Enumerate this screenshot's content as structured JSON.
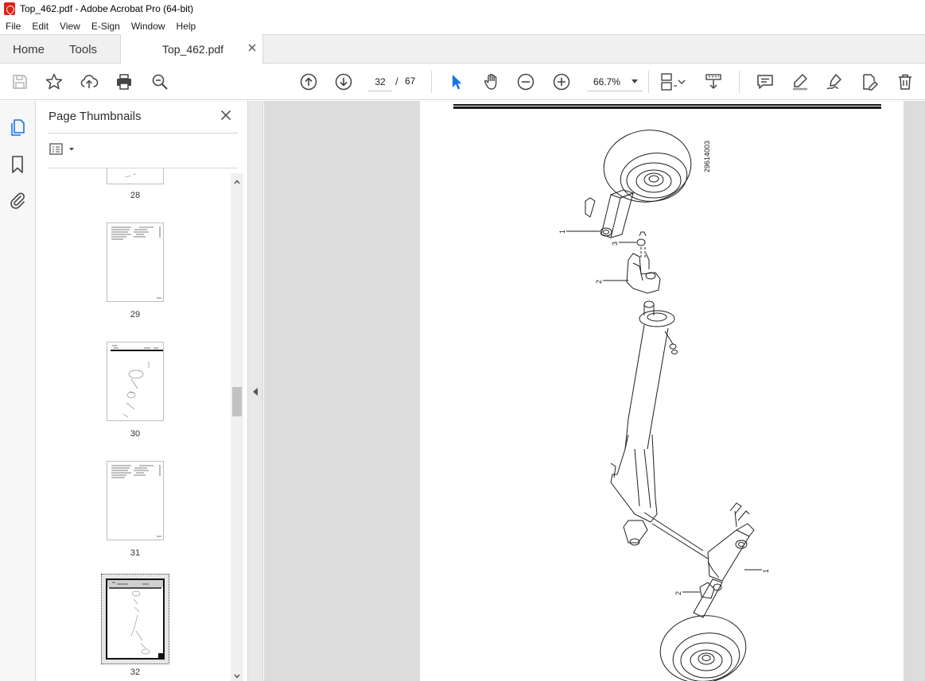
{
  "window": {
    "title": "Top_462.pdf - Adobe Acrobat Pro (64-bit)"
  },
  "menu": [
    "File",
    "Edit",
    "View",
    "E-Sign",
    "Window",
    "Help"
  ],
  "tabs": {
    "home": "Home",
    "tools": "Tools",
    "document": "Top_462.pdf"
  },
  "toolbar": {
    "current_page": "32",
    "separator": "/",
    "total_pages": "67",
    "zoom": "66.7%"
  },
  "thumbnails_panel": {
    "title": "Page Thumbnails",
    "pages": [
      "28",
      "29",
      "30",
      "31",
      "32"
    ],
    "selected_page": "32"
  },
  "document_page": {
    "figure_id": "29614003",
    "callouts": [
      "1",
      "3",
      "2",
      "1",
      "2"
    ]
  },
  "colors": {
    "accent": "#1473e6",
    "acrobat_red": "#e22017",
    "workspace": "#dcdcdc"
  }
}
